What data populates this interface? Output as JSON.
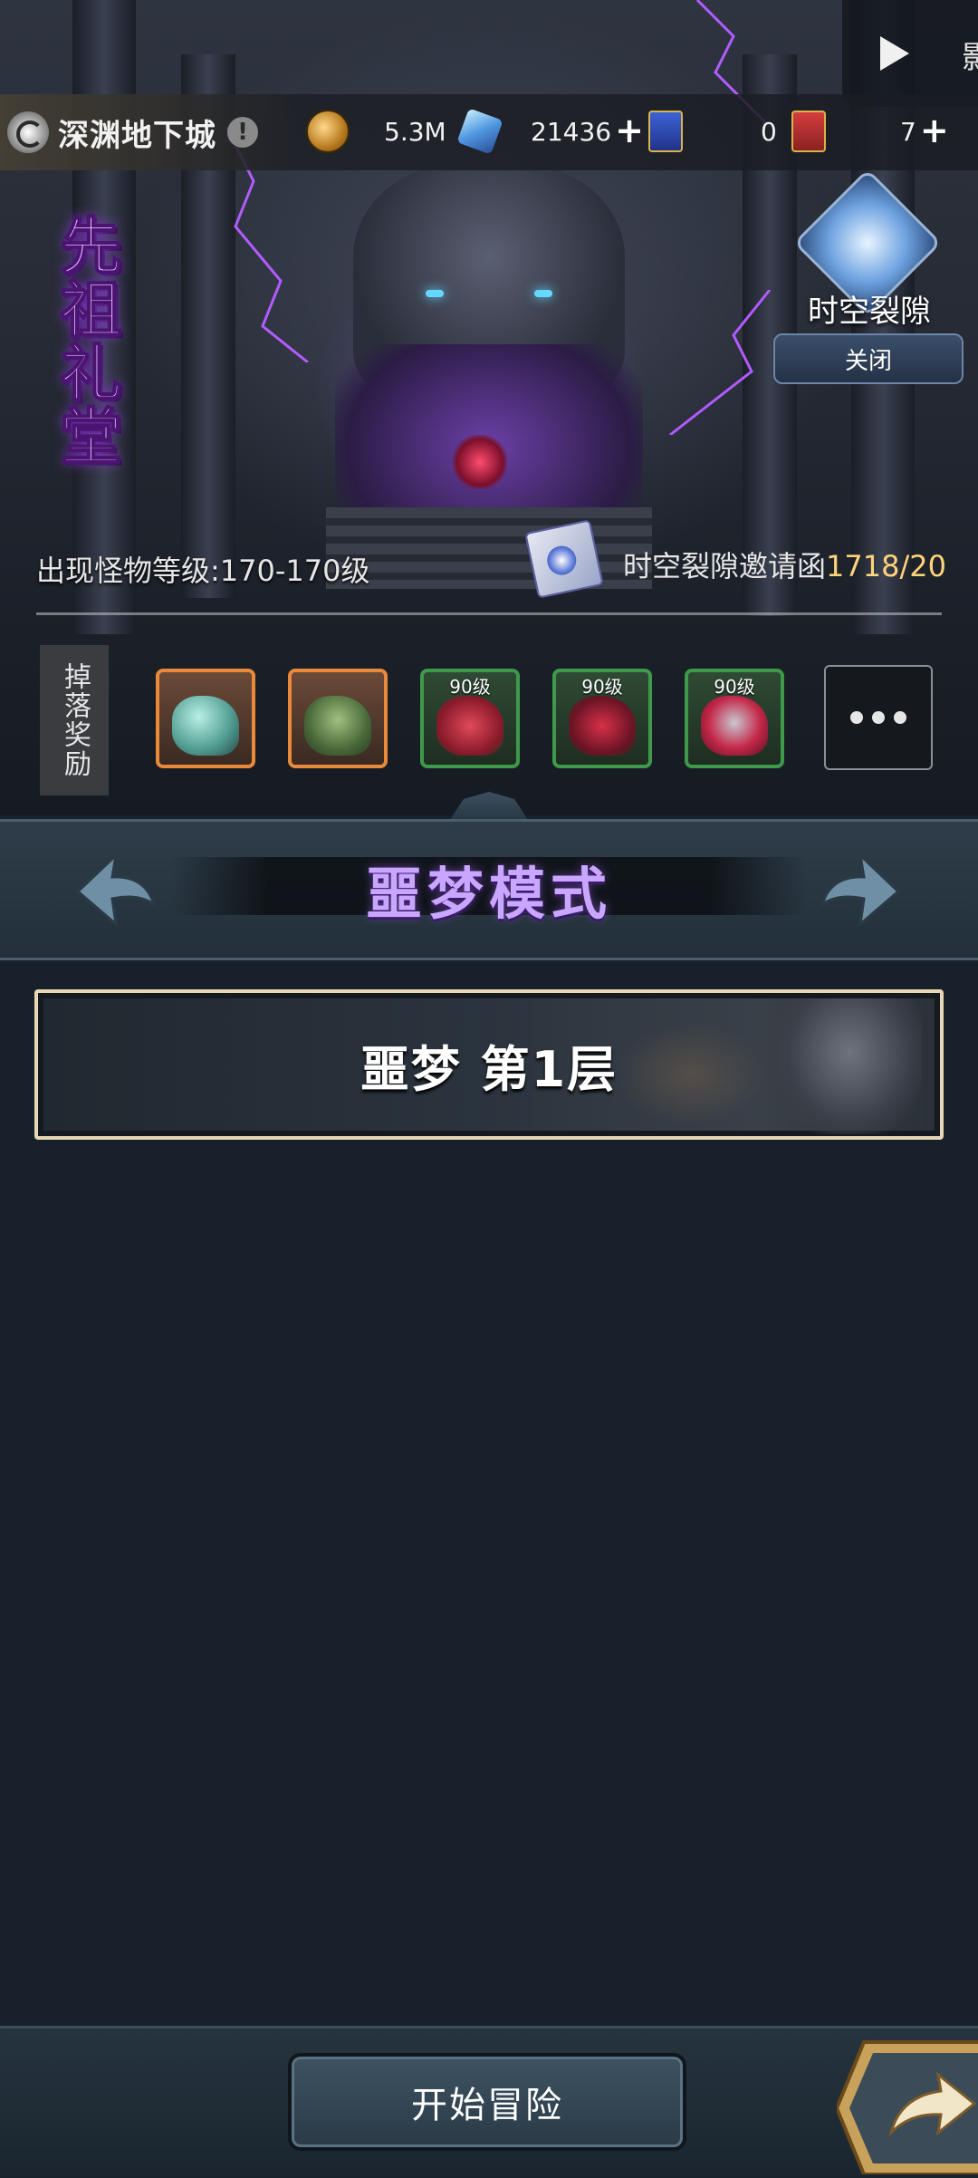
{
  "top_tab": {
    "text": "影"
  },
  "dungeon": {
    "name": "深渊地下城",
    "info_symbol": "!"
  },
  "resources": {
    "gold": "5.3M",
    "gems": "21436",
    "blue_ticket": "0",
    "red_ticket": "7",
    "plus_symbol": "+"
  },
  "banner": {
    "title": "先祖礼堂"
  },
  "rift": {
    "label": "时空裂隙",
    "close_label": "关闭"
  },
  "monster_level": "出现怪物等级:170-170级",
  "invite": {
    "label": "时空裂隙邀请函",
    "count": "1718/20"
  },
  "drops": {
    "label": "掉落奖励",
    "items": [
      {
        "level": "",
        "frame": "orange"
      },
      {
        "level": "",
        "frame": "orange"
      },
      {
        "level": "90级",
        "frame": "green"
      },
      {
        "level": "90级",
        "frame": "green"
      },
      {
        "level": "90级",
        "frame": "green"
      }
    ]
  },
  "mode": {
    "title": "噩梦模式"
  },
  "level_row": {
    "label": "噩梦 第1层"
  },
  "start_button": {
    "label": "开始冒险"
  },
  "colors": {
    "mode_title": "#c9a6ff",
    "invite_count": "#ffd37a",
    "orange_frame": "#e88a3a",
    "green_frame": "#3e9a4a",
    "level_border": "#e8d7b4"
  }
}
